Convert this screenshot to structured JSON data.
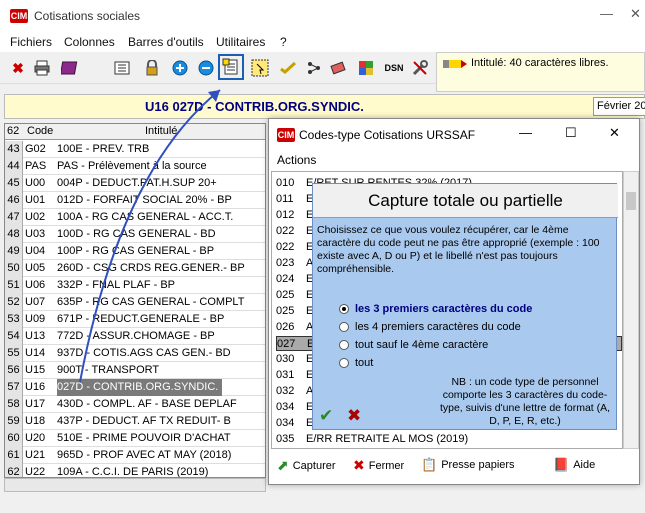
{
  "app": {
    "logo": "CIM",
    "title": "Cotisations sociales"
  },
  "window_controls": {
    "minimize": "—",
    "maximize": "☐",
    "close": "✕"
  },
  "menu": [
    "Fichiers",
    "Colonnes",
    "Barres d'outils",
    "Utilitaires",
    "?"
  ],
  "toolbar": {
    "icons": [
      "close-icon",
      "print-icon",
      "book-icon",
      "list-icon",
      "lock-icon",
      "plus-icon",
      "minus-icon",
      "capture-icon",
      "select-icon",
      "check-icon",
      "tree-icon",
      "eraser-icon",
      "grid-icon",
      "dsn-icon",
      "tools-icon"
    ],
    "dsn_label": "DSN"
  },
  "info": {
    "text": "Intitulé: 40 caractères libres."
  },
  "record": {
    "title": "U16 027D - CONTRIB.ORG.SYNDIC.",
    "month": "Février 20"
  },
  "grid": {
    "headers": {
      "num": "62",
      "code": "Code",
      "label": "Intitulé"
    },
    "rows": [
      {
        "n": "43",
        "code": "G02",
        "label": "100E - PREV. TRB"
      },
      {
        "n": "44",
        "code": "PAS",
        "label": "PAS - Prélèvement à la source"
      },
      {
        "n": "45",
        "code": "U00",
        "label": "004P - DEDUCT.PAT.H.SUP 20+"
      },
      {
        "n": "46",
        "code": "U01",
        "label": "012D - FORFAIT SOCIAL 20% - BP"
      },
      {
        "n": "47",
        "code": "U02",
        "label": "100A - RG CAS GENERAL - ACC.T."
      },
      {
        "n": "48",
        "code": "U03",
        "label": "100D - RG CAS GENERAL - BD"
      },
      {
        "n": "49",
        "code": "U04",
        "label": "100P - RG CAS GENERAL - BP"
      },
      {
        "n": "50",
        "code": "U05",
        "label": "260D - CSG CRDS REG.GENER.- BP"
      },
      {
        "n": "51",
        "code": "U06",
        "label": "332P - FNAL PLAF - BP"
      },
      {
        "n": "52",
        "code": "U07",
        "label": "635P - RG CAS GENERAL - COMPLT"
      },
      {
        "n": "53",
        "code": "U09",
        "label": "671P - REDUCT.GENERALE - BP"
      },
      {
        "n": "54",
        "code": "U13",
        "label": "772D - ASSUR.CHOMAGE - BP"
      },
      {
        "n": "55",
        "code": "U14",
        "label": "937D - COTIS.AGS CAS GEN.- BD"
      },
      {
        "n": "56",
        "code": "U15",
        "label": "900T - TRANSPORT"
      },
      {
        "n": "57",
        "code": "U16",
        "label": "027D - CONTRIB.ORG.SYNDIC."
      },
      {
        "n": "58",
        "code": "U17",
        "label": "430D - COMPL. AF - BASE DEPLAF"
      },
      {
        "n": "59",
        "code": "U18",
        "label": "437P - DEDUCT. AF TX REDUIT- B"
      },
      {
        "n": "60",
        "code": "U20",
        "label": "510E - PRIME POUVOIR D'ACHAT"
      },
      {
        "n": "61",
        "code": "U21",
        "label": "965D - PROF AVEC AT MAY (2018)"
      },
      {
        "n": "62",
        "code": "U22",
        "label": "109A - C.C.I. DE PARIS (2019)"
      }
    ]
  },
  "dialog": {
    "title": "Codes-type Cotisations URSSAF",
    "menu": "Actions",
    "list": [
      {
        "code": "010",
        "label": "E/RET SUR RENTES 32% (2017)"
      },
      {
        "code": "011",
        "label": "E"
      },
      {
        "code": "012",
        "label": "E"
      },
      {
        "code": "022",
        "label": "E"
      },
      {
        "code": "022",
        "label": "E"
      },
      {
        "code": "023",
        "label": "A"
      },
      {
        "code": "024",
        "label": "E"
      },
      {
        "code": "025",
        "label": "E"
      },
      {
        "code": "025",
        "label": "E"
      },
      {
        "code": "026",
        "label": "A"
      },
      {
        "code": "027",
        "label": "E"
      },
      {
        "code": "030",
        "label": "E"
      },
      {
        "code": "031",
        "label": "E"
      },
      {
        "code": "032",
        "label": "A"
      },
      {
        "code": "034",
        "label": "E"
      },
      {
        "code": "034",
        "label": "E"
      },
      {
        "code": "035",
        "label": "E/RR RETRAITE AL MOS (2019)"
      }
    ],
    "buttons": {
      "capture": "Capturer",
      "close": "Fermer",
      "clipboard": "Presse papiers",
      "help": "Aide"
    }
  },
  "capture_panel": {
    "title": "Capture totale ou partielle",
    "description": "Choisissez ce que vous voulez récupérer, car le 4ème caractère du code peut ne pas être approprié (exemple : 100 existe avec A, D ou P) et le libellé n'est pas toujours compréhensible.",
    "options": [
      "les 3 premiers caractères du code",
      "les 4 premiers caractères du code",
      "tout sauf le 4ème caractère",
      "tout"
    ],
    "selected": 0,
    "note": "NB : un code type de personnel comporte les 3 caractères du code-type, suivis d'une lettre de format (A, D, P, E, R, etc.)",
    "ok": "✔",
    "cancel": "✖"
  },
  "colors": {
    "accent": "#1a5fb4",
    "selection": "#7a7a7a",
    "panel": "#a9c9ee",
    "info": "#fffde0"
  }
}
